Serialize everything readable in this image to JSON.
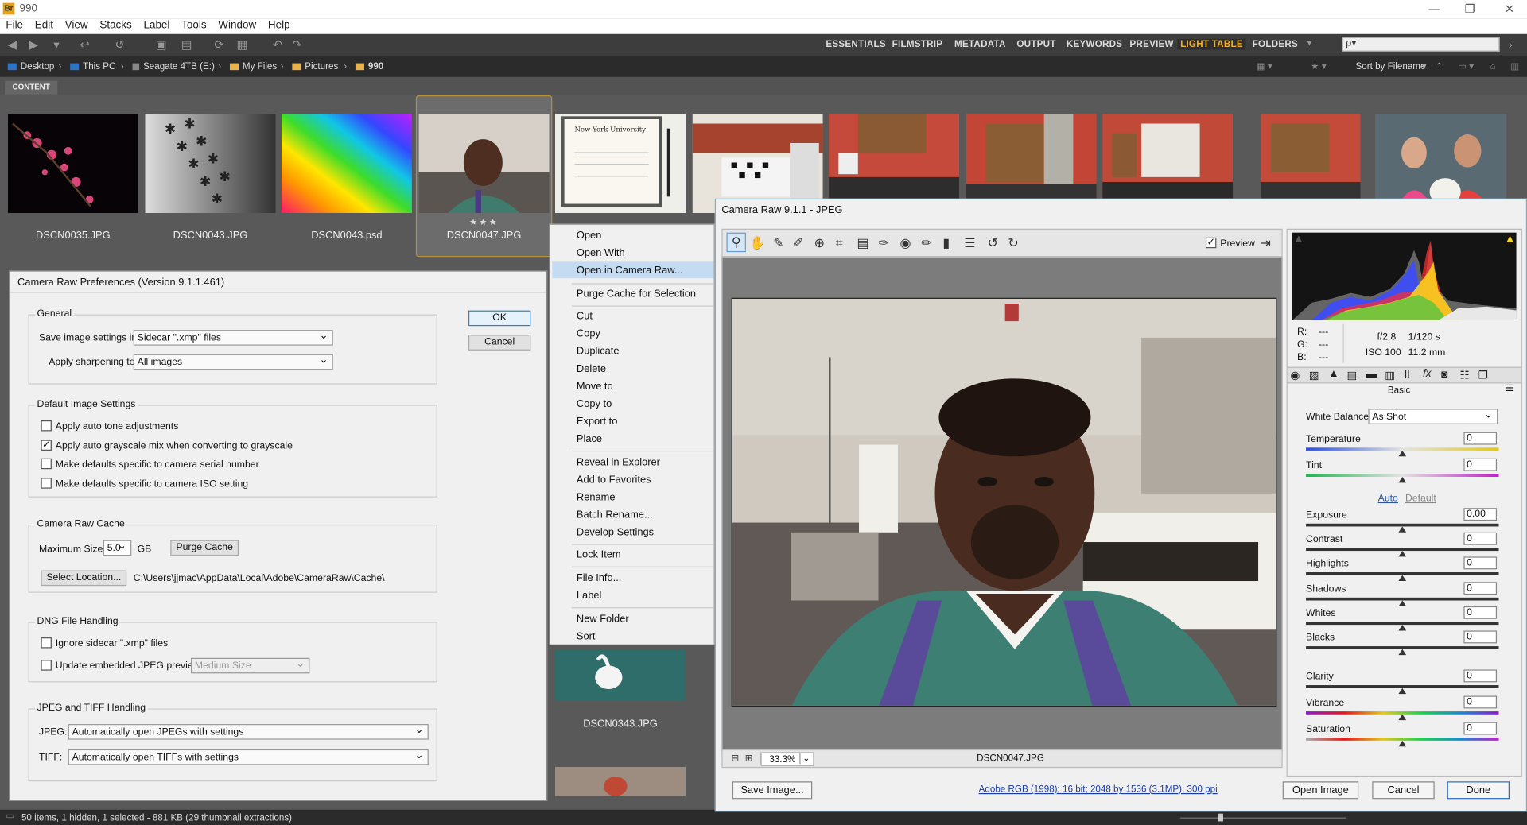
{
  "app": {
    "title": "990",
    "icon_label": "Br"
  },
  "menu": [
    "File",
    "Edit",
    "View",
    "Stacks",
    "Label",
    "Tools",
    "Window",
    "Help"
  ],
  "workspaces": [
    "ESSENTIALS",
    "FILMSTRIP",
    "METADATA",
    "OUTPUT",
    "KEYWORDS",
    "PREVIEW",
    "LIGHT TABLE",
    "FOLDERS"
  ],
  "active_workspace": "LIGHT TABLE",
  "search": {
    "placeholder": "ρ▾"
  },
  "breadcrumbs": [
    "Desktop",
    "This PC",
    "Seagate 4TB (E:)",
    "My Files",
    "Pictures",
    "990"
  ],
  "sort_label": "Sort by Filename",
  "content_tab": "CONTENT",
  "thumbnails": [
    {
      "name": "DSCN0035.JPG"
    },
    {
      "name": "DSCN0043.JPG"
    },
    {
      "name": "DSCN0043.psd"
    },
    {
      "name": "DSCN0047.JPG",
      "rating": "★★★",
      "selected": true
    },
    {
      "name": "DSCN0343.JPG"
    }
  ],
  "status": "50 items, 1 hidden, 1 selected - 881 KB (29 thumbnail extractions)",
  "prefs": {
    "title": "Camera Raw Preferences  (Version 9.1.1.461)",
    "ok": "OK",
    "cancel": "Cancel",
    "general": {
      "label": "General",
      "save_label": "Save image settings in:",
      "save_value": "Sidecar \".xmp\" files",
      "sharpen_label": "Apply sharpening to:",
      "sharpen_value": "All images"
    },
    "defaults": {
      "label": "Default Image Settings",
      "items": [
        {
          "text": "Apply auto tone adjustments",
          "checked": false
        },
        {
          "text": "Apply auto grayscale mix when converting to grayscale",
          "checked": true
        },
        {
          "text": "Make defaults specific to camera serial number",
          "checked": false
        },
        {
          "text": "Make defaults specific to camera ISO setting",
          "checked": false
        }
      ]
    },
    "cache": {
      "label": "Camera Raw Cache",
      "max_label": "Maximum Size:",
      "max_value": "5.0",
      "unit": "GB",
      "purge": "Purge Cache",
      "select": "Select Location...",
      "path": "C:\\Users\\jjmac\\AppData\\Local\\Adobe\\CameraRaw\\Cache\\"
    },
    "dng": {
      "label": "DNG File Handling",
      "ignore": "Ignore sidecar \".xmp\" files",
      "update": "Update embedded JPEG previews:",
      "update_value": "Medium Size"
    },
    "jpeg_tiff": {
      "label": "JPEG and TIFF Handling",
      "jpeg_label": "JPEG:",
      "jpeg_value": "Automatically open JPEGs with settings",
      "tiff_label": "TIFF:",
      "tiff_value": "Automatically open TIFFs with settings"
    }
  },
  "context_menu": [
    "Open",
    "Open With",
    "Open in Camera Raw...",
    "Purge Cache for Selection",
    "Cut",
    "Copy",
    "Duplicate",
    "Delete",
    "Move to",
    "Copy to",
    "Export to",
    "Place",
    "Reveal in Explorer",
    "Add to Favorites",
    "Rename",
    "Batch Rename...",
    "Develop Settings",
    "Lock Item",
    "File Info...",
    "Label",
    "New Folder",
    "Sort"
  ],
  "acr": {
    "title": "Camera Raw 9.1.1  -  JPEG",
    "preview_label": "Preview",
    "zoom": "33.3%",
    "filename": "DSCN0047.JPG",
    "rgb": {
      "r": "R:",
      "g": "G:",
      "b": "B:",
      "dash": "---"
    },
    "exif": {
      "aperture": "f/2.8",
      "shutter": "1/120 s",
      "iso": "ISO 100",
      "focal": "11.2 mm"
    },
    "panel_title": "Basic",
    "white_balance_label": "White Balance:",
    "white_balance_value": "As Shot",
    "auto": "Auto",
    "default": "Default",
    "sliders": [
      {
        "label": "Temperature",
        "value": "0"
      },
      {
        "label": "Tint",
        "value": "0"
      },
      {
        "label": "Exposure",
        "value": "0.00"
      },
      {
        "label": "Contrast",
        "value": "0"
      },
      {
        "label": "Highlights",
        "value": "0"
      },
      {
        "label": "Shadows",
        "value": "0"
      },
      {
        "label": "Whites",
        "value": "0"
      },
      {
        "label": "Blacks",
        "value": "0"
      },
      {
        "label": "Clarity",
        "value": "0"
      },
      {
        "label": "Vibrance",
        "value": "0"
      },
      {
        "label": "Saturation",
        "value": "0"
      }
    ],
    "save_image": "Save Image...",
    "workflow": "Adobe RGB (1998); 16 bit; 2048 by 1536 (3.1MP); 300 ppi",
    "open_image": "Open Image",
    "cancel": "Cancel",
    "done": "Done"
  }
}
